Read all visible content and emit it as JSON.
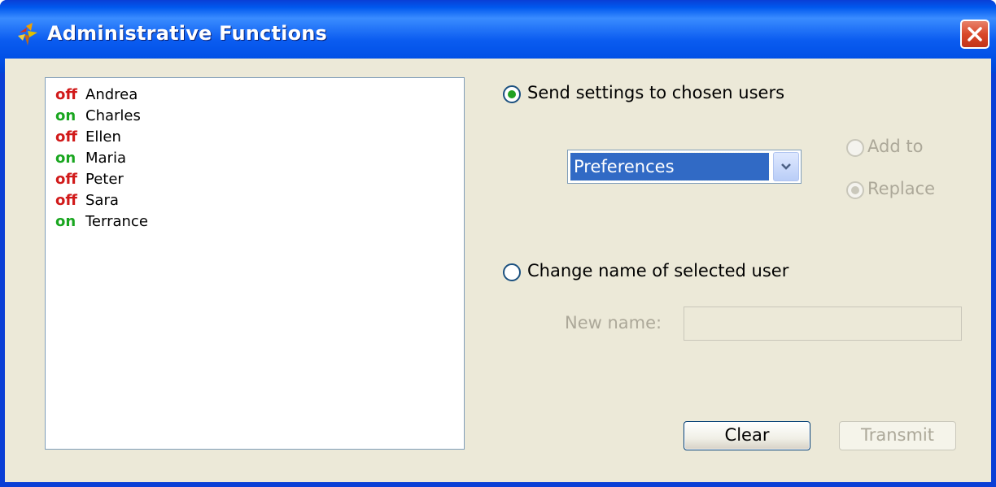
{
  "window": {
    "title": "Administrative Functions",
    "close_icon": "close-icon",
    "app_icon": "app-icon"
  },
  "users": [
    {
      "status": "off",
      "name": "Andrea"
    },
    {
      "status": "on",
      "name": "Charles"
    },
    {
      "status": "off",
      "name": "Ellen"
    },
    {
      "status": "on",
      "name": "Maria"
    },
    {
      "status": "off",
      "name": "Peter"
    },
    {
      "status": "off",
      "name": "Sara"
    },
    {
      "status": "on",
      "name": "Terrance"
    }
  ],
  "send_settings": {
    "label": "Send settings to chosen users",
    "selected": true,
    "dropdown_value": "Preferences",
    "add_to_label": "Add to",
    "replace_label": "Replace",
    "mode_selected": "Replace"
  },
  "change_name": {
    "label": "Change name of selected user",
    "selected": false,
    "new_name_label": "New name:",
    "new_name_value": ""
  },
  "buttons": {
    "clear": "Clear",
    "transmit": "Transmit"
  },
  "colors": {
    "status_off": "#d11a1a",
    "status_on": "#19a61f",
    "titlebar": "#0058ee",
    "dialog_bg": "#ece9d8"
  }
}
